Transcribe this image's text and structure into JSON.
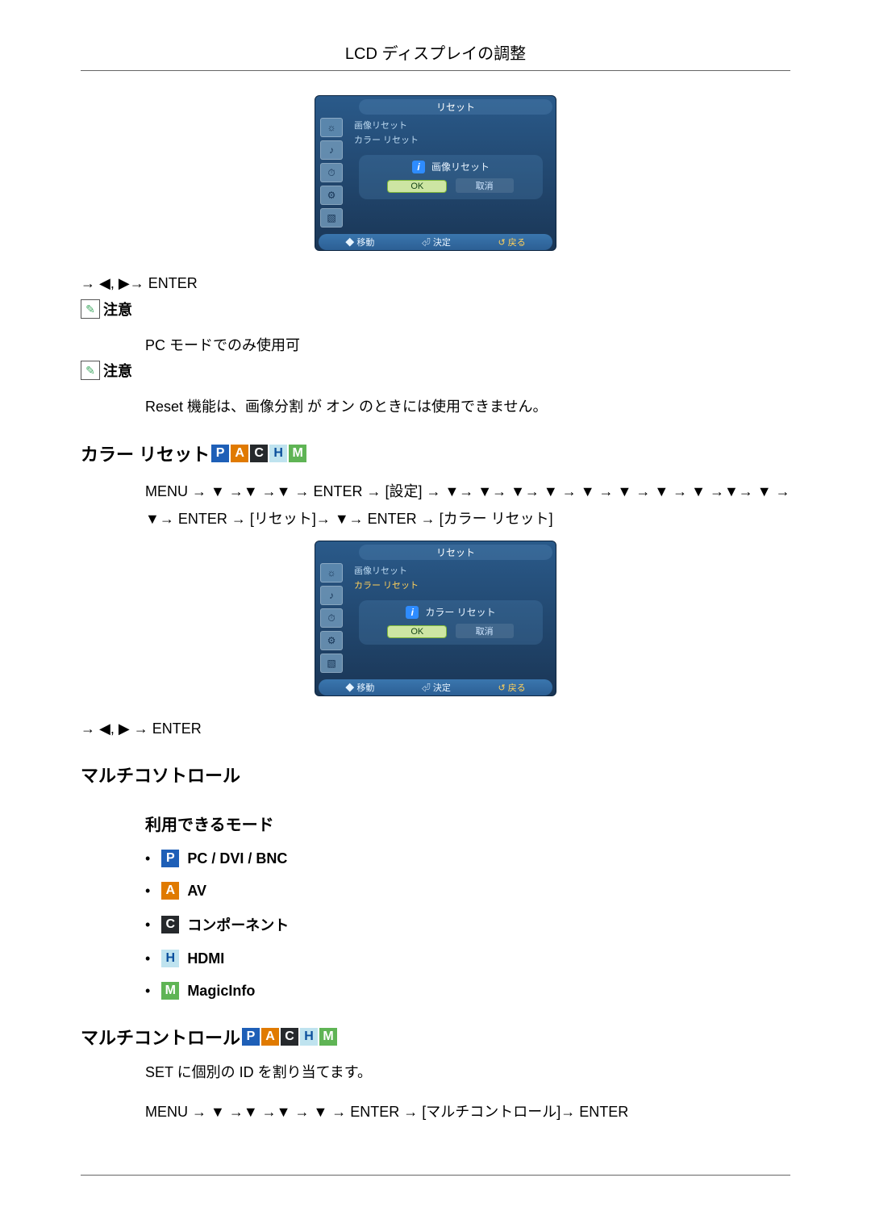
{
  "header": {
    "title": "LCD ディスプレイの調整"
  },
  "osd1": {
    "title": "リセット",
    "line1": "画像リセット",
    "line2": "カラー リセット",
    "popup_title": "画像リセット",
    "btn_ok": "OK",
    "btn_cancel": "取消",
    "foot_move": "◆ 移動",
    "foot_ok": "⏎ 決定",
    "foot_return": "↺ 戻る"
  },
  "nav_enter1": "→ ◀,  ▶→ ENTER",
  "note_label": "注意",
  "note_pc_only": "PC モードでのみ使用可",
  "note_reset": "Reset 機能は、画像分割 が オン のときには使用できません。",
  "section_color_reset": "カラー リセット",
  "badges": {
    "P": "P",
    "A": "A",
    "C": "C",
    "H": "H",
    "M": "M"
  },
  "breadcrumb_color_reset": "MENU → ▼ →▼ →▼ → ENTER → [設定] → ▼→ ▼→ ▼→ ▼ → ▼ → ▼ → ▼ → ▼ →▼→ ▼ → ▼→ ENTER → [リセット]→ ▼→ ENTER → [カラー リセット]",
  "osd2": {
    "title": "リセット",
    "line1": "画像リセット",
    "line2": "カラー リセット",
    "popup_title": "カラー リセット",
    "btn_ok": "OK",
    "btn_cancel": "取消",
    "foot_move": "◆ 移動",
    "foot_ok": "⏎ 決定",
    "foot_return": "↺ 戻る"
  },
  "nav_enter2": "→ ◀,  ▶ → ENTER",
  "section_multi1": "マルチコソトロール",
  "section_avail_modes": "利用できるモード",
  "modes": {
    "pc": "PC / DVI / BNC",
    "av": "AV",
    "component": "コンポーネント",
    "hdmi": "HDMI",
    "magicinfo": "MagicInfo"
  },
  "section_multi2": "マルチコントロール",
  "multi_desc": "SET に個別の ID を割り当てます。",
  "breadcrumb_multi": "MENU → ▼ →▼ →▼ → ▼ → ENTER → [マルチコントロール]→ ENTER"
}
